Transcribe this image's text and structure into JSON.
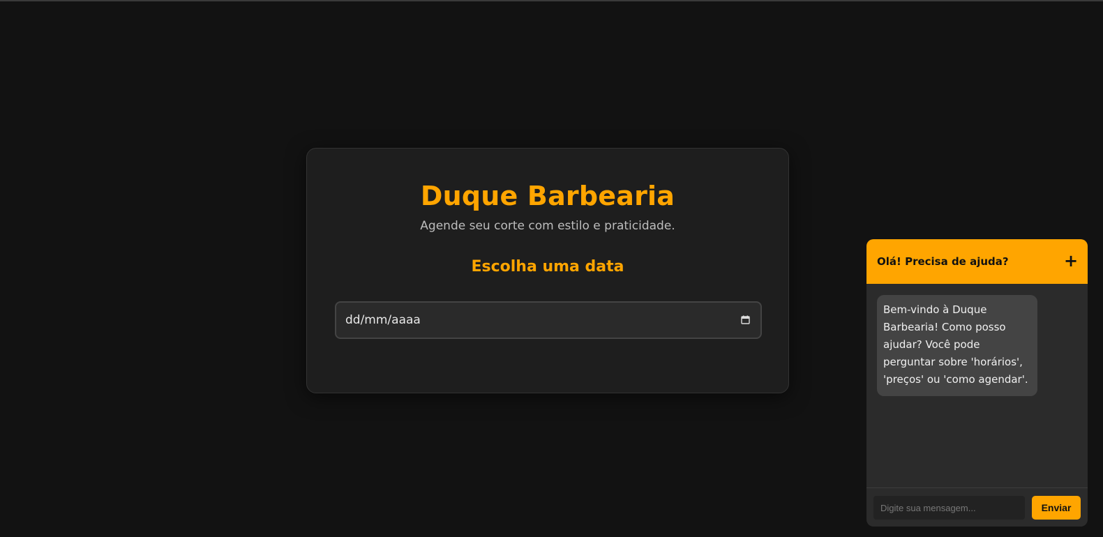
{
  "booking": {
    "title": "Duque Barbearia",
    "subtitle": "Agende seu corte com estilo e praticidade.",
    "section_title": "Escolha uma data",
    "date_input": {
      "display": "dd/mm/aaaa",
      "icon": "calendar-icon"
    }
  },
  "chat": {
    "header_title": "Olá! Precisa de ajuda?",
    "toggle_label": "+",
    "messages": [
      {
        "from": "bot",
        "text": "Bem-vindo à Duque Barbearia! Como posso ajudar? Você pode perguntar sobre 'horários', 'preços' ou 'como agendar'."
      }
    ],
    "input_placeholder": "Digite sua mensagem...",
    "send_label": "Enviar"
  },
  "colors": {
    "background": "#121212",
    "card": "#1e1e1e",
    "accent": "#ffa500",
    "bubble": "#444444"
  }
}
